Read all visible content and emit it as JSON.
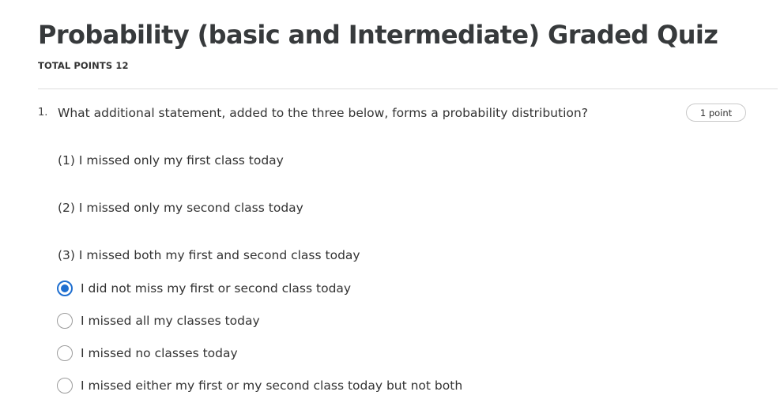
{
  "quiz": {
    "title": "Probability (basic and Intermediate) Graded Quiz",
    "total_points": "TOTAL POINTS 12"
  },
  "question": {
    "number": "1.",
    "text": "What additional statement, added to the three below, forms a probability distribution?",
    "points_badge": "1 point",
    "statements": [
      "(1) I missed only my first class today",
      "(2) I missed only my second class today",
      "(3) I missed both my first and second class today"
    ],
    "options": [
      {
        "label": "I did not miss my first or second class today",
        "selected": true
      },
      {
        "label": "I missed all my classes today",
        "selected": false
      },
      {
        "label": "I missed no classes today",
        "selected": false
      },
      {
        "label": "I missed either my first or my second class today but not both",
        "selected": false
      }
    ]
  },
  "colors": {
    "accent": "#1f6fd0",
    "text": "#333333",
    "divider": "#dddddd"
  }
}
